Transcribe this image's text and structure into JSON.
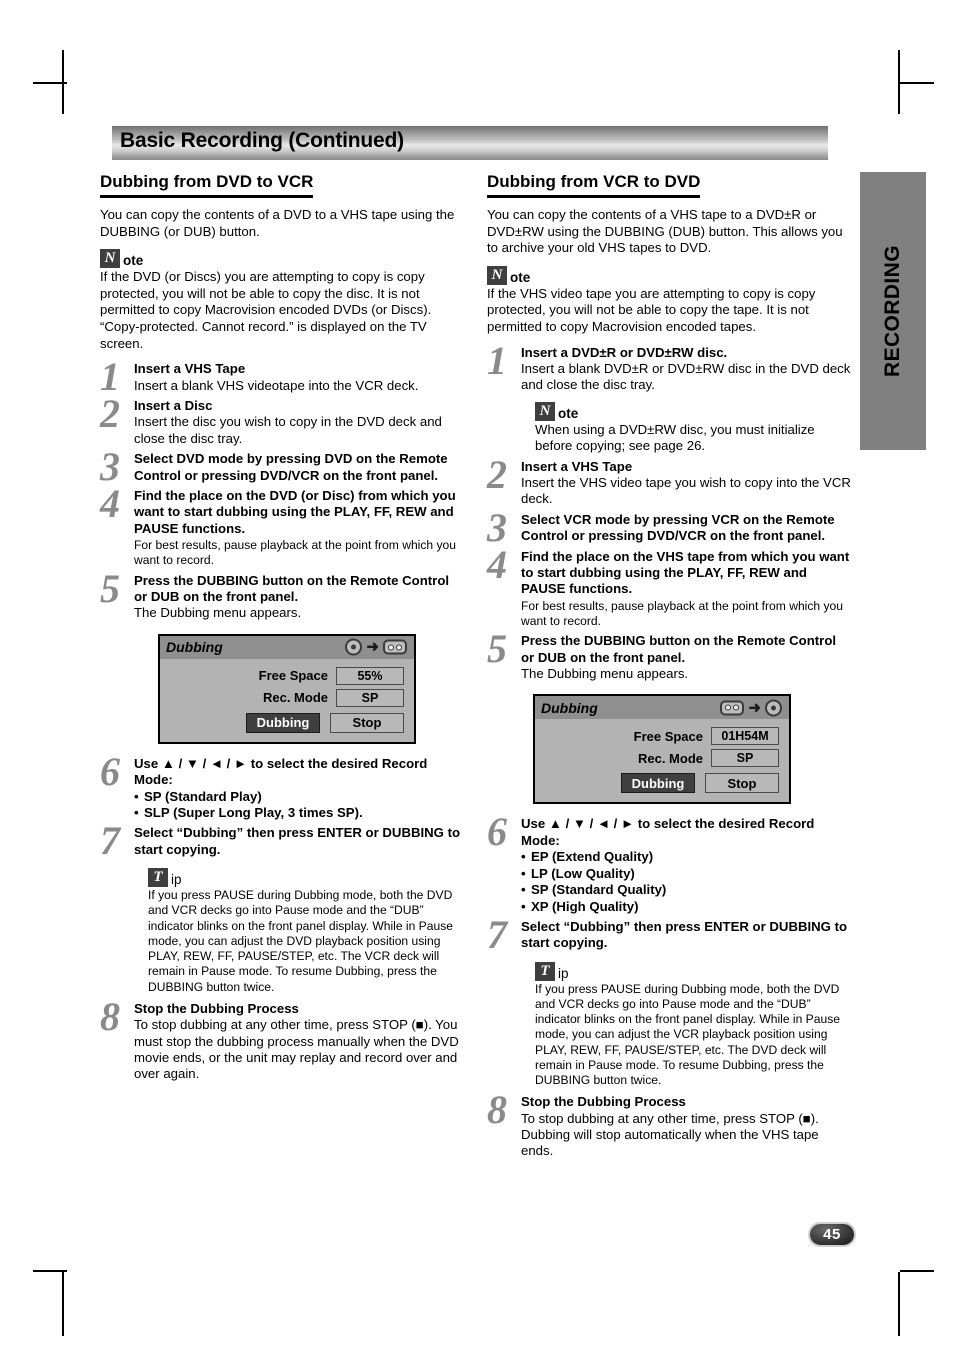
{
  "header": {
    "title": "Basic Recording (Continued)"
  },
  "side_tab": {
    "label": "RECORDING"
  },
  "page_number": "45",
  "badges": {
    "note_glyph": "N",
    "note_word": "ote",
    "tip_glyph": "T",
    "tip_word": "ip"
  },
  "left": {
    "heading": "Dubbing from DVD to VCR",
    "intro": "You can copy the contents of a DVD to a VHS tape using the DUBBING (or DUB) button.",
    "note": "If the DVD (or Discs) you are attempting to copy is copy protected, you will not be able to copy the disc. It is not permitted to copy Macrovision encoded DVDs (or Discs). “Copy-protected. Cannot record.” is displayed on the TV screen.",
    "steps": {
      "s1_num": "1",
      "s1_head": "Insert a VHS Tape",
      "s1_sub": "Insert a blank VHS videotape into the VCR deck.",
      "s2_num": "2",
      "s2_head": "Insert a Disc",
      "s2_sub": "Insert the disc you wish to copy in the DVD deck and close the disc tray.",
      "s3_num": "3",
      "s3_head": "Select DVD mode by pressing DVD on the Remote Control or pressing DVD/VCR on the front panel.",
      "s4_num": "4",
      "s4_head": "Find the place on the DVD (or Disc) from which you want to start dubbing using the PLAY, FF, REW and PAUSE functions.",
      "s4_note": "For best results, pause playback at the point from which you want to record.",
      "s5_num": "5",
      "s5_head": "Press the DUBBING button on the Remote Control or DUB on the front panel.",
      "s5_sub": "The Dubbing menu appears.",
      "s6_num": "6",
      "s6_head": "Use ▲ / ▼ / ◄ / ► to select the desired Record Mode:",
      "s6_options": [
        "SP (Standard Play)",
        "SLP (Super Long Play, 3 times SP)."
      ],
      "s7_num": "7",
      "s7_head": "Select “Dubbing” then press ENTER or DUBBING to start copying.",
      "s7_tip": "If you press PAUSE during Dubbing mode, both the DVD and VCR decks go into Pause mode and the “DUB” indicator blinks on the front panel display. While in Pause mode, you can adjust the DVD playback position using PLAY, REW, FF, PAUSE/STEP, etc. The VCR deck will remain in Pause mode. To resume Dubbing, press the DUBBING button twice.",
      "s8_num": "8",
      "s8_head": "Stop the Dubbing Process",
      "s8_sub": "To stop dubbing at any other time, press STOP (■). You must stop the dubbing process manually when the DVD movie ends, or the unit may replay and record over and over again."
    },
    "osd": {
      "title": "Dubbing",
      "icon_from": "disc-icon",
      "icon_arrow": "arrow-right-icon",
      "icon_to": "cassette-icon",
      "free_space_label": "Free Space",
      "free_space_value": "55%",
      "rec_mode_label": "Rec. Mode",
      "rec_mode_value": "SP",
      "btn_dubbing": "Dubbing",
      "btn_stop": "Stop"
    }
  },
  "right": {
    "heading": "Dubbing from VCR to DVD",
    "intro": "You can copy the contents of a VHS tape to a DVD±R or DVD±RW using the DUBBING (DUB) button. This allows you to archive your old VHS tapes to DVD.",
    "note": "If the VHS video tape you are attempting to copy is copy protected, you will not be able to copy the tape. It is not permitted to copy Macrovision encoded tapes.",
    "steps": {
      "s1_num": "1",
      "s1_head": "Insert a DVD±R or DVD±RW disc.",
      "s1_sub": "Insert a blank DVD±R or DVD±RW disc in the DVD deck and close the disc tray.",
      "s1_note": "When using a DVD±RW disc, you must initialize before copying; see page 26.",
      "s2_num": "2",
      "s2_head": "Insert a VHS Tape",
      "s2_sub": "Insert the VHS video tape you wish to copy into the VCR deck.",
      "s3_num": "3",
      "s3_head": "Select VCR mode by pressing VCR on the Remote Control or pressing DVD/VCR on the front panel.",
      "s4_num": "4",
      "s4_head": "Find the place on the VHS tape from which you want to start dubbing using the PLAY, FF, REW and PAUSE functions.",
      "s4_note": "For best results, pause playback at the point from which you want to record.",
      "s5_num": "5",
      "s5_head": "Press the DUBBING button on the Remote Control or DUB on the front panel.",
      "s5_sub": "The Dubbing menu appears.",
      "s6_num": "6",
      "s6_head": "Use ▲ / ▼ / ◄ / ► to select the desired Record Mode:",
      "s6_options": [
        "EP (Extend Quality)",
        "LP (Low Quality)",
        "SP (Standard Quality)",
        "XP (High Quality)"
      ],
      "s7_num": "7",
      "s7_head": "Select “Dubbing” then press ENTER or DUBBING to start copying.",
      "s7_tip": "If you press PAUSE during Dubbing mode, both the DVD and VCR decks go into Pause mode and the “DUB” indicator blinks on the front panel display. While in Pause mode, you can adjust the VCR playback position using PLAY, REW, FF, PAUSE/STEP, etc. The DVD deck will remain in Pause mode. To resume Dubbing, press the DUBBING button twice.",
      "s8_num": "8",
      "s8_head": "Stop the Dubbing Process",
      "s8_sub": "To stop dubbing at any other time, press STOP (■). Dubbing will stop automatically when the VHS tape ends."
    },
    "osd": {
      "title": "Dubbing",
      "icon_from": "cassette-icon",
      "icon_arrow": "arrow-right-icon",
      "icon_to": "disc-icon",
      "free_space_label": "Free Space",
      "free_space_value": "01H54M",
      "rec_mode_label": "Rec. Mode",
      "rec_mode_value": "SP",
      "btn_dubbing": "Dubbing",
      "btn_stop": "Stop"
    }
  }
}
